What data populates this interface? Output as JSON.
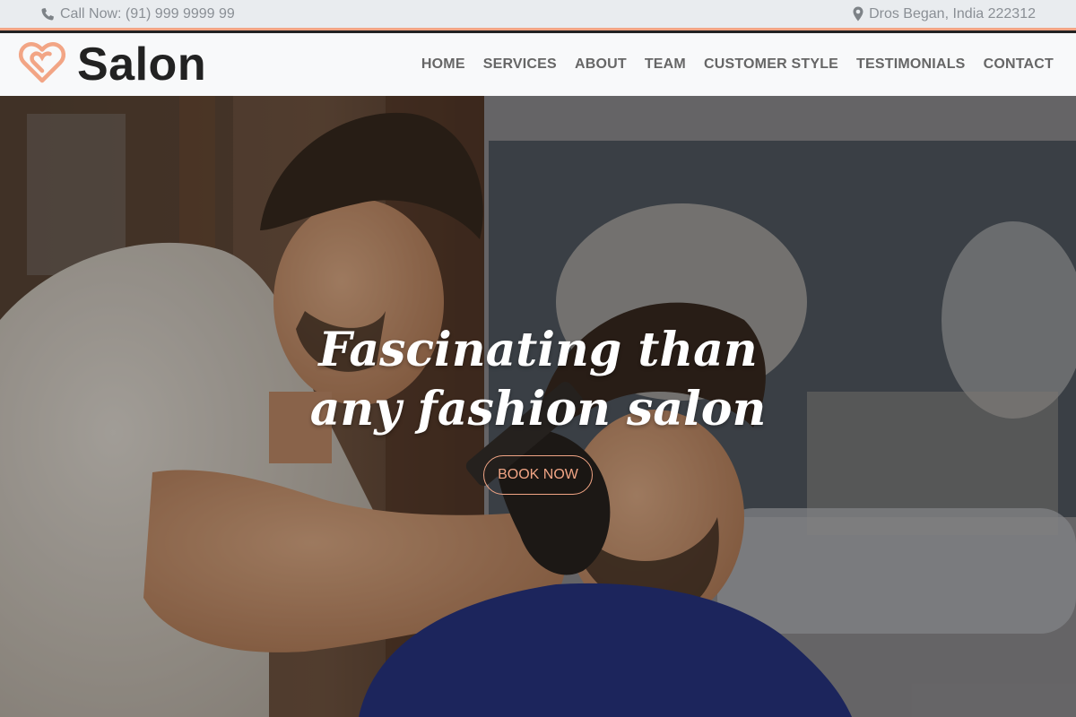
{
  "topbar": {
    "phone_icon": "phone-icon",
    "phone_text": "Call Now: (91) 999 9999 99",
    "location_icon": "map-marker-icon",
    "location_text": "Dros Began, India 222312"
  },
  "brand": {
    "logo_icon": "heart-logo-icon",
    "name": "Salon"
  },
  "nav": {
    "items": [
      "HOME",
      "SERVICES",
      "ABOUT",
      "TEAM",
      "CUSTOMER STYLE",
      "TESTIMONIALS",
      "CONTACT"
    ]
  },
  "hero": {
    "headline": "Fascinating than any fashion salon",
    "cta_label": "BOOK NOW"
  },
  "colors": {
    "accent": "#f2a585",
    "topbar_bg": "#e9ecef",
    "navbar_bg": "#f8f9fa",
    "nav_text": "#666666",
    "brand_text": "#222222"
  }
}
